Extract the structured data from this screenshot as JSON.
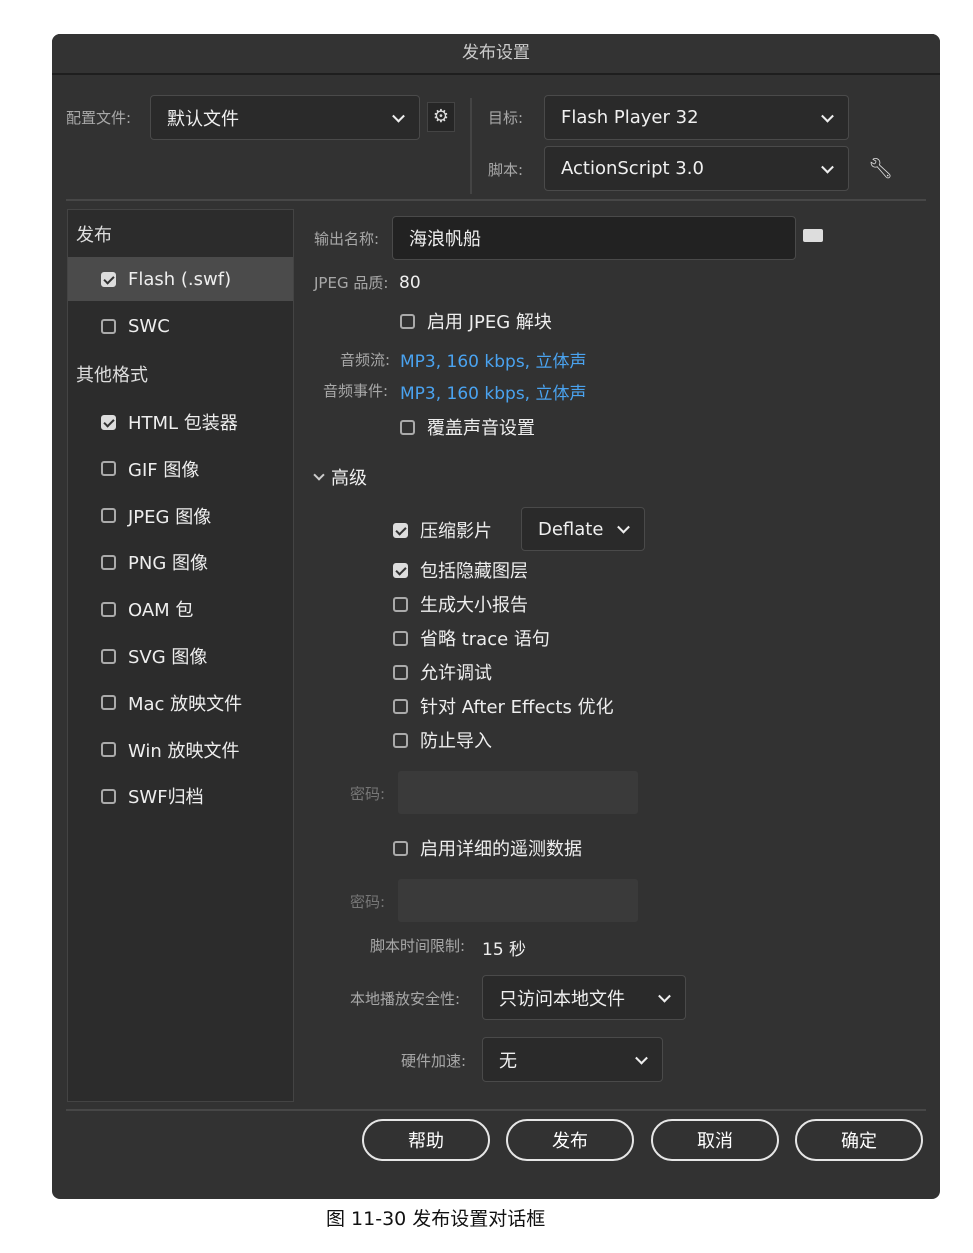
{
  "dialog": {
    "title": "发布设置"
  },
  "top": {
    "profile_label": "配置文件:",
    "profile_value": "默认文件",
    "target_label": "目标:",
    "target_value": "Flash Player 32",
    "script_label": "脚本:",
    "script_value": "ActionScript 3.0"
  },
  "left": {
    "publish_header": "发布",
    "publish_items": [
      {
        "label": "Flash (.swf)",
        "checked": true
      },
      {
        "label": "SWC",
        "checked": false
      }
    ],
    "other_header": "其他格式",
    "other_items": [
      {
        "label": "HTML 包装器",
        "checked": true
      },
      {
        "label": "GIF 图像",
        "checked": false
      },
      {
        "label": "JPEG 图像",
        "checked": false
      },
      {
        "label": "PNG 图像",
        "checked": false
      },
      {
        "label": "OAM 包",
        "checked": false
      },
      {
        "label": "SVG 图像",
        "checked": false
      },
      {
        "label": "Mac 放映文件",
        "checked": false
      },
      {
        "label": "Win 放映文件",
        "checked": false
      },
      {
        "label": "SWF归档",
        "checked": false
      }
    ]
  },
  "main": {
    "output_label": "输出名称:",
    "output_value": "海浪帆船",
    "jpeg_label": "JPEG 品质:",
    "jpeg_value": "80",
    "deblock": "启用 JPEG 解块",
    "stream_label": "音频流:",
    "stream_value": "MP3, 160 kbps, 立体声",
    "event_label": "音频事件:",
    "event_value": "MP3, 160 kbps, 立体声",
    "override": "覆盖声音设置",
    "advanced": "高级",
    "compress": "压缩影片",
    "compress_mode": "Deflate",
    "include_hidden": "包括隐藏图层",
    "size_report": "生成大小报告",
    "omit_trace": "省略 trace 语句",
    "allow_debug": "允许调试",
    "ae_opt": "针对 After Effects 优化",
    "protect": "防止导入",
    "password_label": "密码:",
    "telemetry": "启用详细的遥测数据",
    "password2_label": "密码:",
    "script_limit_label": "脚本时间限制:",
    "script_limit_value": "15 秒",
    "local_sec_label": "本地播放安全性:",
    "local_sec_value": "只访问本地文件",
    "hw_label": "硬件加速:",
    "hw_value": "无"
  },
  "buttons": {
    "help": "帮助",
    "publish": "发布",
    "cancel": "取消",
    "ok": "确定"
  },
  "caption": "图 11-30 发布设置对话框"
}
